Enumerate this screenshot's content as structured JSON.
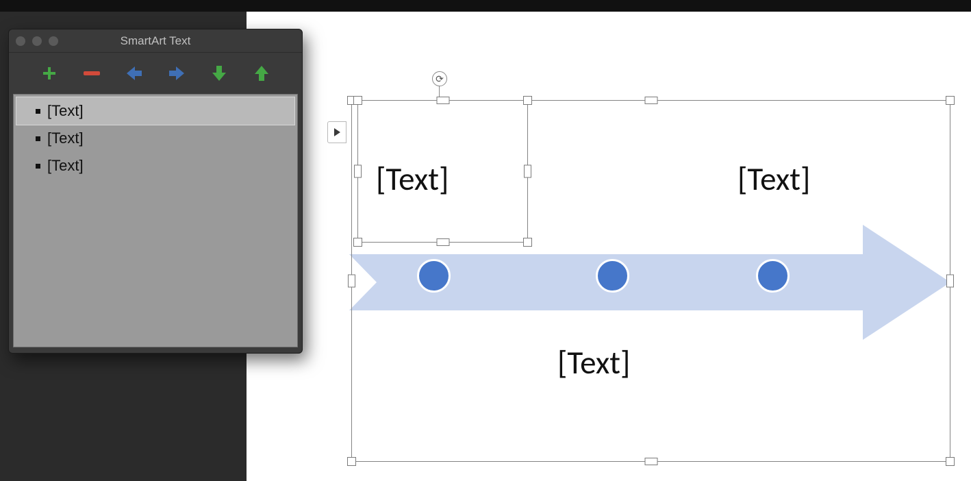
{
  "panel": {
    "title": "SmartArt Text",
    "toolbar": {
      "add": "add-bullet",
      "remove": "remove-bullet",
      "promote": "promote",
      "demote": "demote",
      "move_down": "move-down",
      "move_up": "move-up"
    },
    "items": [
      {
        "text": "[Text]",
        "selected": true
      },
      {
        "text": "[Text]",
        "selected": false
      },
      {
        "text": "[Text]",
        "selected": false
      }
    ]
  },
  "smartart": {
    "labels": {
      "top_left": "[Text]",
      "top_right": "[Text]",
      "bottom_mid": "[Text]"
    },
    "colors": {
      "arrow_fill": "#c8d5ee",
      "dot_fill": "#4677ca"
    }
  }
}
